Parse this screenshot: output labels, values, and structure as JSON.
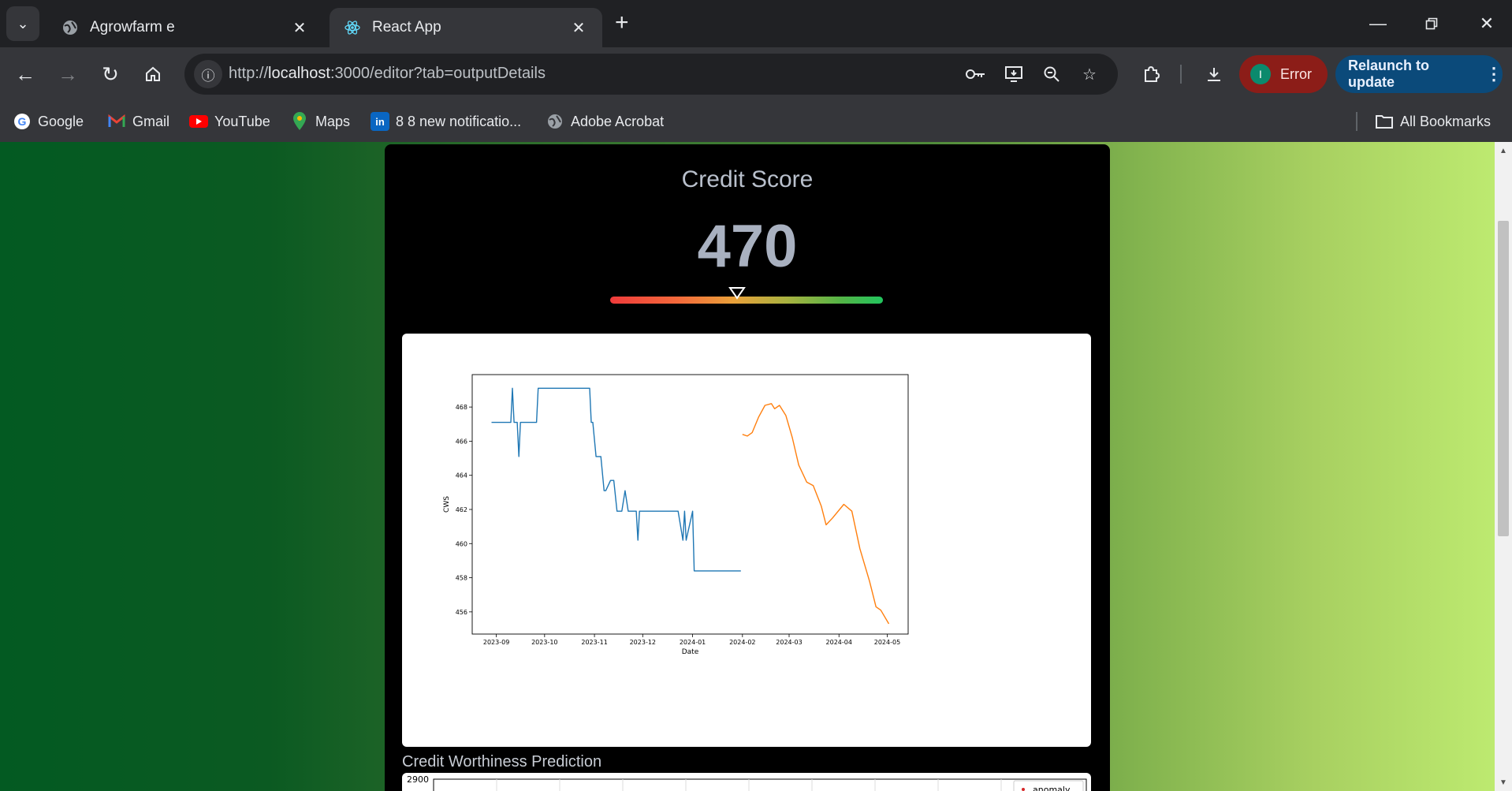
{
  "browser": {
    "tabs": [
      {
        "title": "Agrowfarm e",
        "active": false
      },
      {
        "title": "React App",
        "active": true
      }
    ],
    "url_prefix": "http://",
    "url_host": "localhost",
    "url_rest": ":3000/editor?tab=outputDetails",
    "error_label": "Error",
    "error_avatar": "I",
    "relaunch_label": "Relaunch to update",
    "bookmarks": [
      {
        "label": "Google",
        "icon": "google-icon"
      },
      {
        "label": "Gmail",
        "icon": "gmail-icon"
      },
      {
        "label": "YouTube",
        "icon": "youtube-icon"
      },
      {
        "label": "Maps",
        "icon": "maps-icon"
      },
      {
        "label": "8 8 new notificatio...",
        "icon": "linkedin-icon"
      },
      {
        "label": "Adobe Acrobat",
        "icon": "globe-icon"
      }
    ],
    "all_bookmarks_label": "All Bookmarks"
  },
  "page": {
    "score_title": "Credit Score",
    "score_value": "470",
    "gauge_level": 0.465,
    "section_title": "Credit Worthiness Prediction",
    "chart2_top_tick": "2900",
    "chart2_legend": "anomaly"
  },
  "chart_data": {
    "type": "line",
    "title": "",
    "xlabel": "Date",
    "ylabel": "CWS",
    "xlim": [
      "2023-08-17",
      "2024-05-14"
    ],
    "ylim": [
      454.7,
      469.9
    ],
    "xticks": [
      "2023-09",
      "2023-10",
      "2023-11",
      "2023-12",
      "2024-01",
      "2024-02",
      "2024-03",
      "2024-04",
      "2024-05"
    ],
    "yticks": [
      456,
      458,
      460,
      462,
      464,
      466,
      468
    ],
    "grid": false,
    "series": [
      {
        "color": "#1f77b4",
        "points": [
          [
            "2023-08-29",
            467.1
          ],
          [
            "2023-09-10",
            467.1
          ],
          [
            "2023-09-11",
            469.1
          ],
          [
            "2023-09-12",
            467.1
          ],
          [
            "2023-09-14",
            467.1
          ],
          [
            "2023-09-15",
            465.1
          ],
          [
            "2023-09-16",
            467.1
          ],
          [
            "2023-09-26",
            467.1
          ],
          [
            "2023-09-27",
            469.1
          ],
          [
            "2023-10-29",
            469.1
          ],
          [
            "2023-10-30",
            467.1
          ],
          [
            "2023-10-31",
            467.1
          ],
          [
            "2023-11-02",
            465.1
          ],
          [
            "2023-11-05",
            465.1
          ],
          [
            "2023-11-07",
            463.1
          ],
          [
            "2023-11-08",
            463.1
          ],
          [
            "2023-11-11",
            463.7
          ],
          [
            "2023-11-13",
            463.7
          ],
          [
            "2023-11-15",
            461.9
          ],
          [
            "2023-11-18",
            461.9
          ],
          [
            "2023-11-20",
            463.1
          ],
          [
            "2023-11-22",
            461.9
          ],
          [
            "2023-11-27",
            461.9
          ],
          [
            "2023-11-28",
            460.2
          ],
          [
            "2023-11-29",
            461.9
          ],
          [
            "2023-12-23",
            461.9
          ],
          [
            "2023-12-26",
            460.2
          ],
          [
            "2023-12-27",
            461.9
          ],
          [
            "2023-12-28",
            460.2
          ],
          [
            "2024-01-01",
            461.9
          ],
          [
            "2024-01-02",
            458.4
          ],
          [
            "2024-01-31",
            458.4
          ]
        ]
      },
      {
        "color": "#ff7f0e",
        "points": [
          [
            "2024-02-01",
            466.4
          ],
          [
            "2024-02-04",
            466.3
          ],
          [
            "2024-02-07",
            466.5
          ],
          [
            "2024-02-11",
            467.4
          ],
          [
            "2024-02-15",
            468.1
          ],
          [
            "2024-02-19",
            468.2
          ],
          [
            "2024-02-21",
            467.9
          ],
          [
            "2024-02-24",
            468.1
          ],
          [
            "2024-02-28",
            467.5
          ],
          [
            "2024-03-03",
            466.2
          ],
          [
            "2024-03-07",
            464.6
          ],
          [
            "2024-03-12",
            463.6
          ],
          [
            "2024-03-16",
            463.4
          ],
          [
            "2024-03-21",
            462.2
          ],
          [
            "2024-03-24",
            461.1
          ],
          [
            "2024-03-28",
            461.5
          ],
          [
            "2024-04-04",
            462.3
          ],
          [
            "2024-04-09",
            461.9
          ],
          [
            "2024-04-14",
            459.7
          ],
          [
            "2024-04-20",
            457.8
          ],
          [
            "2024-04-24",
            456.3
          ],
          [
            "2024-04-27",
            456.1
          ],
          [
            "2024-05-02",
            455.3
          ]
        ]
      }
    ]
  }
}
